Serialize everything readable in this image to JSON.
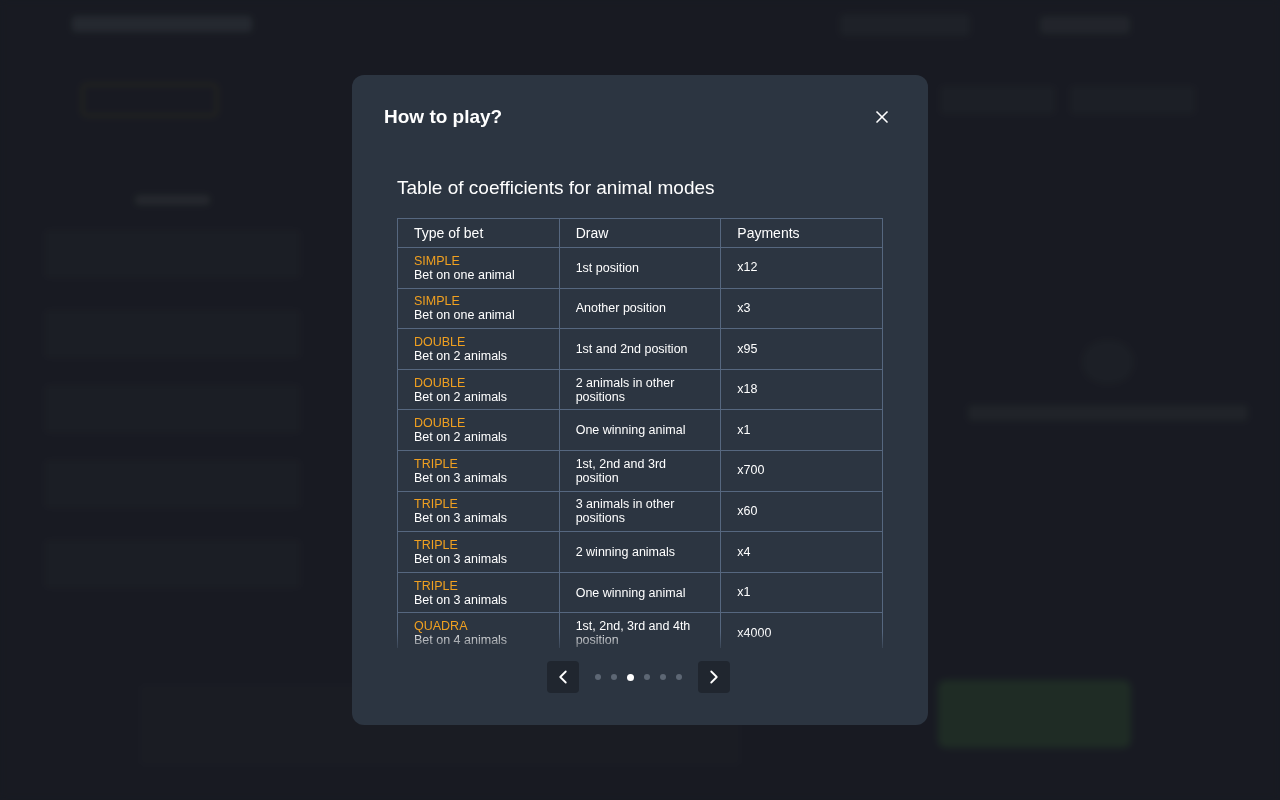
{
  "modal": {
    "title": "How to play?",
    "section_title": "Table of coefficients for animal modes",
    "table": {
      "columns": [
        "Type of bet",
        "Draw",
        "Payments"
      ],
      "rows": [
        {
          "mode": "SIMPLE",
          "description": "Bet on one animal",
          "draw": "1st position",
          "payment": "x12"
        },
        {
          "mode": "SIMPLE",
          "description": "Bet on one animal",
          "draw": "Another position",
          "payment": "x3"
        },
        {
          "mode": "DOUBLE",
          "description": "Bet on 2 animals",
          "draw": "1st and 2nd position",
          "payment": "x95"
        },
        {
          "mode": "DOUBLE",
          "description": "Bet on 2 animals",
          "draw": "2 animals in other positions",
          "payment": "x18"
        },
        {
          "mode": "DOUBLE",
          "description": "Bet on 2 animals",
          "draw": "One winning animal",
          "payment": "x1"
        },
        {
          "mode": "TRIPLE",
          "description": "Bet on 3 animals",
          "draw": "1st, 2nd and 3rd position",
          "payment": "x700"
        },
        {
          "mode": "TRIPLE",
          "description": "Bet on 3 animals",
          "draw": "3 animals in other positions",
          "payment": "x60"
        },
        {
          "mode": "TRIPLE",
          "description": "Bet on 3 animals",
          "draw": "2 winning animals",
          "payment": "x4"
        },
        {
          "mode": "TRIPLE",
          "description": "Bet on 3 animals",
          "draw": "One winning animal",
          "payment": "x1"
        },
        {
          "mode": "QUADRA",
          "description": "Bet on 4 animals",
          "draw": "1st, 2nd, 3rd and 4th position",
          "payment": "x4000"
        }
      ]
    },
    "pages": [
      {
        "selected": false
      },
      {
        "selected": false
      },
      {
        "selected": true
      },
      {
        "selected": false
      },
      {
        "selected": false
      },
      {
        "selected": false
      }
    ]
  }
}
